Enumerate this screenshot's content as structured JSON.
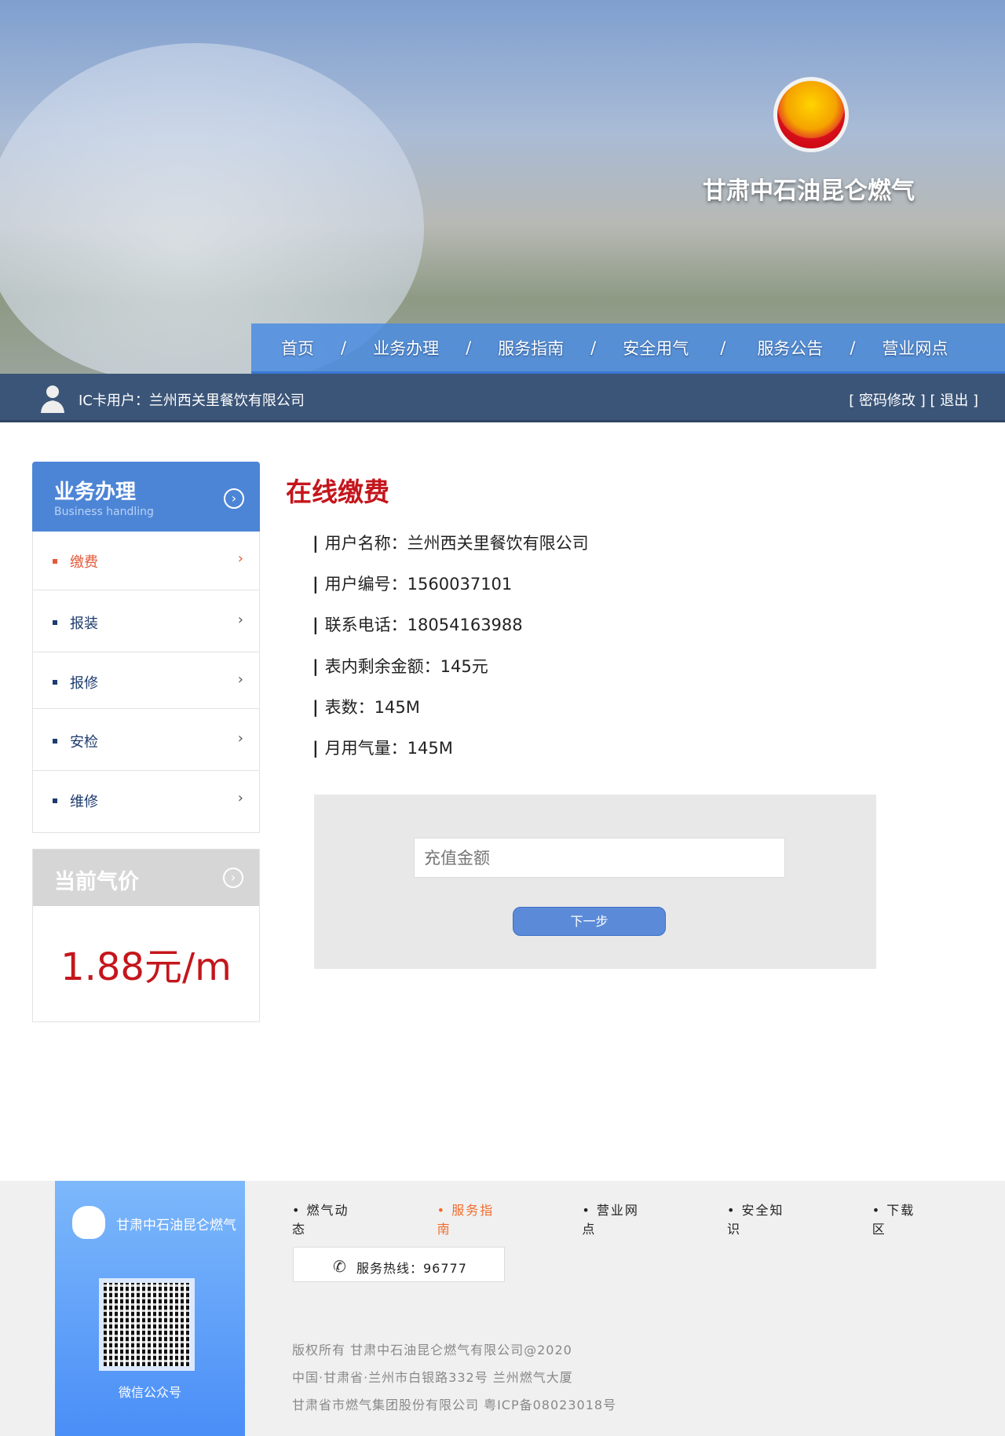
{
  "brand": "甘肃中石油昆仑燃气",
  "nav": [
    "首页",
    "业务办理",
    "服务指南",
    "安全用气",
    "服务公告",
    "营业网点"
  ],
  "user": {
    "label": "IC卡用户：兰州西关里餐饮有限公司",
    "change_password": "[ 密码修改 ]",
    "logout": "[ 退出 ]"
  },
  "sidebar": {
    "title": "业务办理",
    "subtitle": "Business handling",
    "items": [
      {
        "label": "缴费"
      },
      {
        "label": "报装"
      },
      {
        "label": "报修"
      },
      {
        "label": "安检"
      },
      {
        "label": "维修"
      }
    ]
  },
  "price": {
    "title": "当前气价",
    "value": "1.88元/m"
  },
  "main": {
    "title": "在线缴费",
    "info": [
      "用户名称：兰州西关里餐饮有限公司",
      "用户编号：1560037101",
      "联系电话：18054163988",
      "表内剩余金额：145元",
      "表数：145M",
      "月用气量：145M"
    ],
    "amount_placeholder": "充值金额",
    "next": "下一步"
  },
  "footer": {
    "brand": "甘肃中石油昆仑燃气",
    "qr_label": "微信公众号",
    "nav": [
      "燃气动态",
      "服务指南",
      "营业网点",
      "安全知识",
      "下载区"
    ],
    "hotline": "服务热线：96777",
    "copyright": [
      "版权所有 甘肃中石油昆仑燃气有限公司@2020",
      "中国·甘肃省·兰州市白银路332号 兰州燃气大厦",
      "甘肃省市燃气集团股份有限公司  粤ICP备08023018号"
    ]
  }
}
